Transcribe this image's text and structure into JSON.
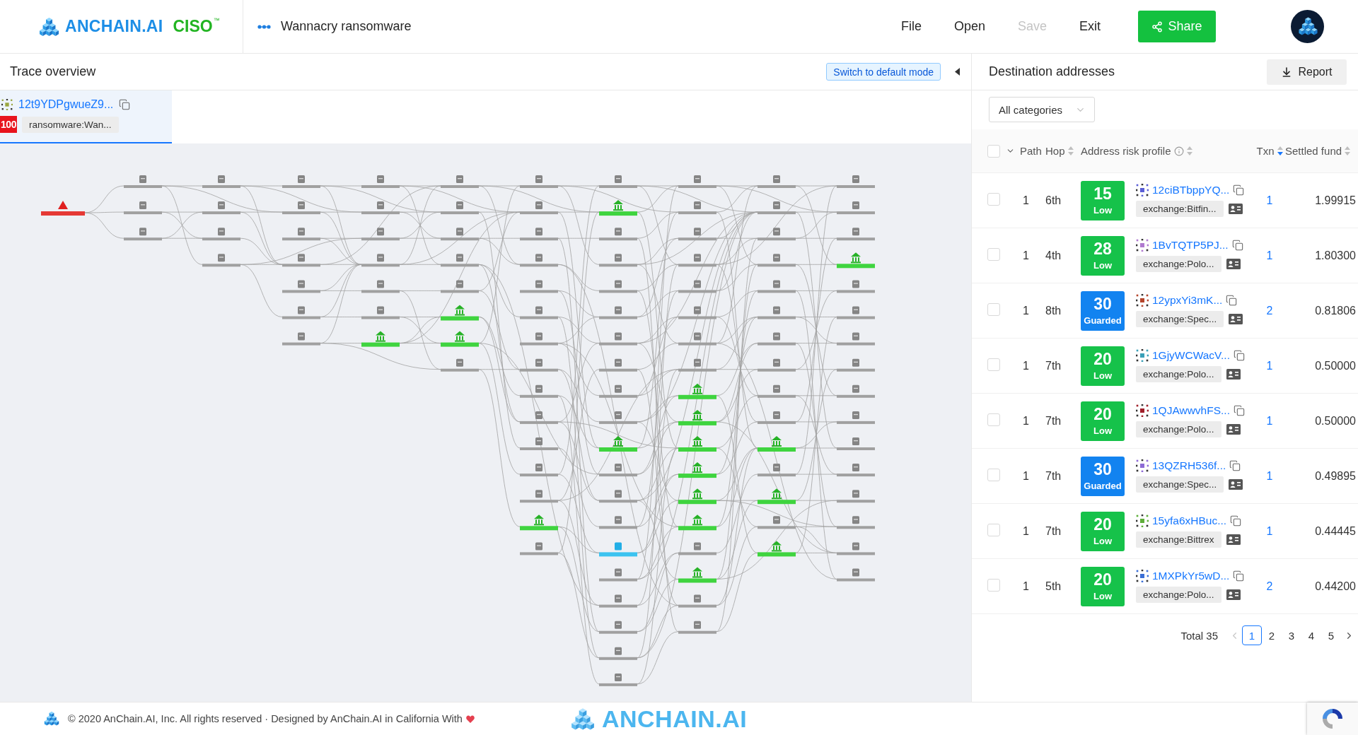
{
  "header": {
    "logo": {
      "brand": "ANCHAIN.AI",
      "product": "CISO",
      "trademark": "™"
    },
    "case_title": "Wannacry ransomware",
    "menu": [
      {
        "label": "File",
        "disabled": false
      },
      {
        "label": "Open",
        "disabled": false
      },
      {
        "label": "Save",
        "disabled": true
      },
      {
        "label": "Exit",
        "disabled": false
      }
    ],
    "share_button": "Share"
  },
  "trace_panel": {
    "title": "Trace overview",
    "mode_button": "Switch to default mode",
    "source": {
      "address": "12t9YDPgwueZ9...",
      "risk_score": "100",
      "tag": "ransomware:Wan...",
      "selected": true
    }
  },
  "destination_panel": {
    "title": "Destination addresses",
    "report_button": "Report",
    "category_filter": "All categories",
    "select_all": {
      "checked": false
    },
    "columns": [
      {
        "label": "Path",
        "sortable": false,
        "sorted_desc": false,
        "info": false
      },
      {
        "label": "Hop",
        "sortable": true,
        "sorted_desc": false,
        "info": false
      },
      {
        "label": "Address risk profile",
        "sortable": true,
        "sorted_desc": false,
        "info": true
      },
      {
        "label": "Txn",
        "sortable": true,
        "sorted_desc": true,
        "info": false
      },
      {
        "label": "Settled fund",
        "sortable": true,
        "sorted_desc": false,
        "info": false
      }
    ],
    "rows": [
      {
        "checked": false,
        "path": "1",
        "hop": "6th",
        "risk": {
          "score": "15",
          "level": "Low",
          "color": "#16c24a"
        },
        "identicon": {
          "color": "#5b5fd6"
        },
        "address": "12ciBTbppYQ...",
        "tag": "exchange:Bitfin...",
        "txn": "1",
        "settled_fund": "1.99915"
      },
      {
        "checked": false,
        "path": "1",
        "hop": "4th",
        "risk": {
          "score": "28",
          "level": "Low",
          "color": "#16c24a"
        },
        "identicon": {
          "color": "#b07ad0"
        },
        "address": "1BvTQTP5PJ...",
        "tag": "exchange:Polo...",
        "txn": "1",
        "settled_fund": "1.80300"
      },
      {
        "checked": false,
        "path": "1",
        "hop": "8th",
        "risk": {
          "score": "30",
          "level": "Guarded",
          "color": "#1283f0"
        },
        "identicon": {
          "color": "#b5452c"
        },
        "address": "12ypxYi3mK...",
        "tag": "exchange:Spec...",
        "txn": "2",
        "settled_fund": "0.81806"
      },
      {
        "checked": false,
        "path": "1",
        "hop": "7th",
        "risk": {
          "score": "20",
          "level": "Low",
          "color": "#16c24a"
        },
        "identicon": {
          "color": "#3aa0b8"
        },
        "address": "1GjyWCWacV...",
        "tag": "exchange:Polo...",
        "txn": "1",
        "settled_fund": "0.50000"
      },
      {
        "checked": false,
        "path": "1",
        "hop": "7th",
        "risk": {
          "score": "20",
          "level": "Low",
          "color": "#16c24a"
        },
        "identicon": {
          "color": "#a01f2a"
        },
        "address": "1QJAwwvhFS...",
        "tag": "exchange:Polo...",
        "txn": "1",
        "settled_fund": "0.50000"
      },
      {
        "checked": false,
        "path": "1",
        "hop": "7th",
        "risk": {
          "score": "30",
          "level": "Guarded",
          "color": "#1283f0"
        },
        "identicon": {
          "color": "#8e6bd6"
        },
        "address": "13QZRH536f...",
        "tag": "exchange:Spec...",
        "txn": "1",
        "settled_fund": "0.49895"
      },
      {
        "checked": false,
        "path": "1",
        "hop": "7th",
        "risk": {
          "score": "20",
          "level": "Low",
          "color": "#16c24a"
        },
        "identicon": {
          "color": "#5fae3a"
        },
        "address": "15yfa6xHBuc...",
        "tag": "exchange:Bittrex",
        "txn": "1",
        "settled_fund": "0.44445"
      },
      {
        "checked": false,
        "path": "1",
        "hop": "5th",
        "risk": {
          "score": "20",
          "level": "Low",
          "color": "#16c24a"
        },
        "identicon": {
          "color": "#3b6fd6"
        },
        "address": "1MXPkYr5wD...",
        "tag": "exchange:Polo...",
        "txn": "2",
        "settled_fund": "0.44200"
      }
    ],
    "pagination": {
      "total": "Total 35",
      "prev_disabled": true,
      "next_disabled": false,
      "pages": [
        {
          "label": "1",
          "selected": true
        },
        {
          "label": "2",
          "selected": false
        },
        {
          "label": "3",
          "selected": false
        },
        {
          "label": "4",
          "selected": false
        },
        {
          "label": "5",
          "selected": false
        }
      ]
    }
  },
  "footer": {
    "copyright": "© 2020 AnChain.AI, Inc. All rights reserved · Designed by AnChain.AI in California With",
    "brand": "ANCHAIN.AI"
  }
}
